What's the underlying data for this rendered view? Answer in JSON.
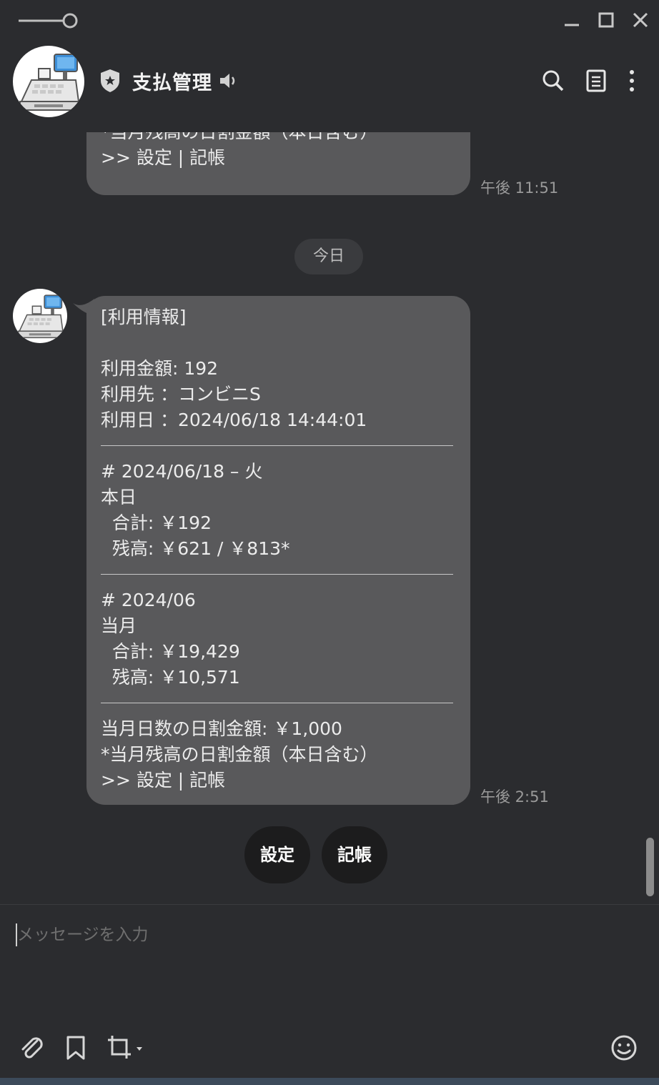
{
  "window": {
    "controls": [
      "pin-icon",
      "minimize-icon",
      "maximize-icon",
      "close-icon"
    ]
  },
  "header": {
    "title": "支払管理",
    "icons": [
      "shield-star-icon",
      "speaker-icon",
      "search-icon",
      "notes-icon",
      "more-vertical-icon"
    ]
  },
  "messages": [
    {
      "lines": [
        "*当月残高の日割金額（本日含む）",
        ">> 設定 | 記帳"
      ],
      "time": "午後 11:51"
    },
    {
      "sections": [
        [
          "[利用情報]",
          "",
          "利用金額: 192",
          "利用先 ：コンビニS",
          "利用日 ：2024/06/18 14:44:01"
        ],
        [
          "# 2024/06/18 – 火",
          "本日",
          "  合計: ￥192",
          "  残高: ￥621 / ￥813*"
        ],
        [
          "# 2024/06",
          "当月",
          "  合計: ￥19,429",
          "  残高: ￥10,571"
        ],
        [
          "当月日数の日割金額: ￥1,000",
          "*当月残高の日割金額（本日含む）",
          ">> 設定 | 記帳"
        ]
      ],
      "time": "午後 2:51"
    }
  ],
  "date_divider": "今日",
  "quick_replies": [
    "設定",
    "記帳"
  ],
  "composer": {
    "placeholder": "メッセージを入力",
    "tools": [
      "attach-icon",
      "bookmark-icon",
      "crop-screenshot-icon",
      "emoji-icon"
    ]
  },
  "colors": {
    "background": "#2b2c2f",
    "bubble": "#59595b",
    "quick_reply": "#1c1c1d"
  }
}
